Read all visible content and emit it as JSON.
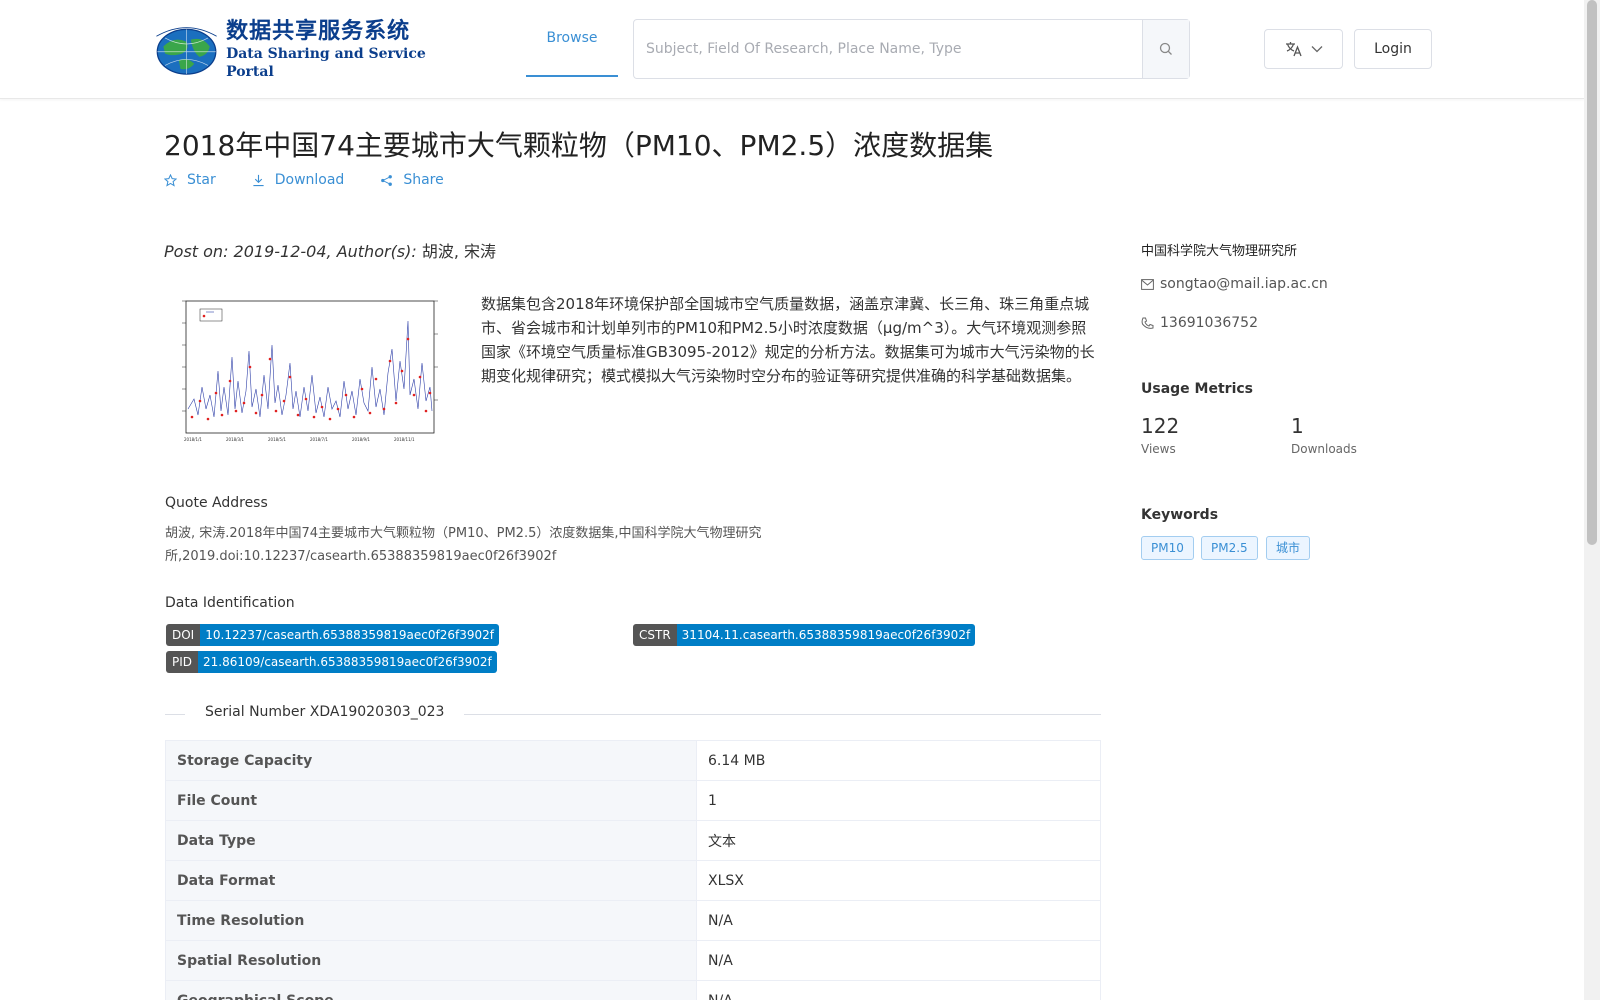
{
  "header": {
    "logo_cn": "数据共享服务系统",
    "logo_en": "Data Sharing and Service Portal",
    "nav_browse": "Browse",
    "search_placeholder": "Subject, Field Of Research, Place Name, Type",
    "login": "Login"
  },
  "dataset": {
    "title": "2018年中国74主要城市大气颗粒物（PM10、PM2.5）浓度数据集",
    "actions": {
      "star": "Star",
      "download": "Download",
      "share": "Share"
    },
    "post_prefix": "Post on: 2019-12-04, Author(s): ",
    "authors": "胡波, 宋涛",
    "description": "数据集包含2018年环境保护部全国城市空气质量数据，涵盖京津冀、长三角、珠三角重点城市、省会城市和计划单列市的PM10和PM2.5小时浓度数据（μg/m^3）。大气环境观测参照国家《环境空气质量标准GB3095-2012》规定的分析方法。数据集可为城市大气污染物的长期变化规律研究；模式模拟大气污染物时空分布的验证等研究提供准确的科学基础数据集。",
    "quote_label": "Quote Address",
    "quote_text": "胡波, 宋涛.2018年中国74主要城市大气颗粒物（PM10、PM2.5）浓度数据集,中国科学院大气物理研究所,2019.doi:10.12237/casearth.65388359819aec0f26f3902f",
    "ident_label": "Data Identification",
    "doi_key": "DOI",
    "doi_value": "10.12237/casearth.65388359819aec0f26f3902f",
    "cstr_key": "CSTR",
    "cstr_value": "31104.11.casearth.65388359819aec0f26f3902f",
    "pid_key": "PID",
    "pid_value": "21.86109/casearth.65388359819aec0f26f3902f",
    "serial": "Serial Number XDA19020303_023",
    "meta": [
      {
        "key": "Storage Capacity",
        "value": "6.14 MB"
      },
      {
        "key": "File Count",
        "value": "1"
      },
      {
        "key": "Data Type",
        "value": "文本"
      },
      {
        "key": "Data Format",
        "value": "XLSX"
      },
      {
        "key": "Time Resolution",
        "value": "N/A"
      },
      {
        "key": "Spatial Resolution",
        "value": "N/A"
      },
      {
        "key": "Geographical Scope",
        "value": "N/A"
      }
    ]
  },
  "sidebar": {
    "org": "中国科学院大气物理研究所",
    "email": "songtao@mail.iap.ac.cn",
    "phone": "13691036752",
    "usage_title": "Usage Metrics",
    "views": "122",
    "views_label": "Views",
    "downloads": "1",
    "downloads_label": "Downloads",
    "keywords_title": "Keywords",
    "keywords": [
      "PM10",
      "PM2.5",
      "城市"
    ]
  },
  "colors": {
    "accent": "#3a8fd4",
    "badge_key": "#555555",
    "badge_value": "#007ec6"
  }
}
